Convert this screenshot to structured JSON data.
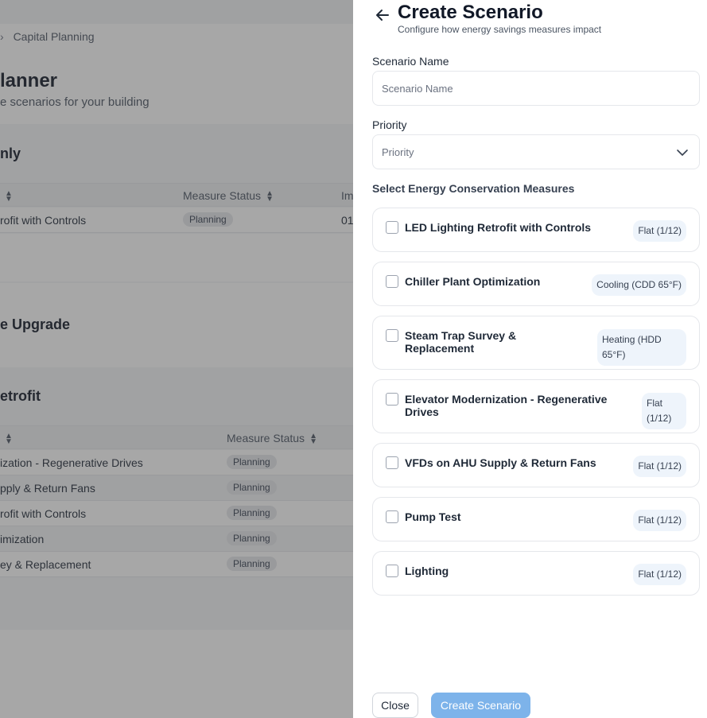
{
  "background": {
    "breadcrumb": "Capital Planning",
    "title": "lanner",
    "subtitle": "e scenarios for your building",
    "groups": [
      {
        "title": "nly",
        "columns": {
          "name_sort": "",
          "status": "Measure Status",
          "impact": "Im"
        },
        "rows": [
          {
            "name": "rofit with Controls",
            "status": "Planning",
            "impact": "01"
          }
        ]
      },
      {
        "title": "e Upgrade"
      },
      {
        "title": "etrofit",
        "columns": {
          "status": "Measure Status"
        },
        "rows": [
          {
            "name": "ization - Regenerative Drives",
            "status": "Planning"
          },
          {
            "name": "pply & Return Fans",
            "status": "Planning"
          },
          {
            "name": "rofit with Controls",
            "status": "Planning"
          },
          {
            "name": "imization",
            "status": "Planning"
          },
          {
            "name": "ey & Replacement",
            "status": "Planning"
          }
        ]
      }
    ]
  },
  "drawer": {
    "back_icon": "arrow-left-icon",
    "title": "Create Scenario",
    "subtitle": "Configure how energy savings measures impact",
    "scenario_name": {
      "label": "Scenario Name",
      "placeholder": "Scenario Name",
      "value": ""
    },
    "priority": {
      "label": "Priority",
      "placeholder": "Priority"
    },
    "ecm_section_label": "Select Energy Conservation Measures",
    "ecms": [
      {
        "name": "LED Lighting Retrofit with Controls",
        "tag": "Flat (1/12)",
        "checked": false
      },
      {
        "name": "Chiller Plant Optimization",
        "tag": "Cooling (CDD 65°F)",
        "checked": false
      },
      {
        "name": "Steam Trap Survey & Replacement",
        "tag": "Heating (HDD 65°F)",
        "checked": false
      },
      {
        "name": "Elevator Modernization - Regenerative Drives",
        "tag": "Flat (1/12)",
        "checked": false
      },
      {
        "name": "VFDs on AHU Supply & Return Fans",
        "tag": "Flat (1/12)",
        "checked": false
      },
      {
        "name": "Pump Test",
        "tag": "Flat (1/12)",
        "checked": false
      },
      {
        "name": "Lighting",
        "tag": "Flat (1/12)",
        "checked": false
      }
    ],
    "close_label": "Close",
    "create_label": "Create Scenario",
    "create_color": "#7db3ea"
  }
}
